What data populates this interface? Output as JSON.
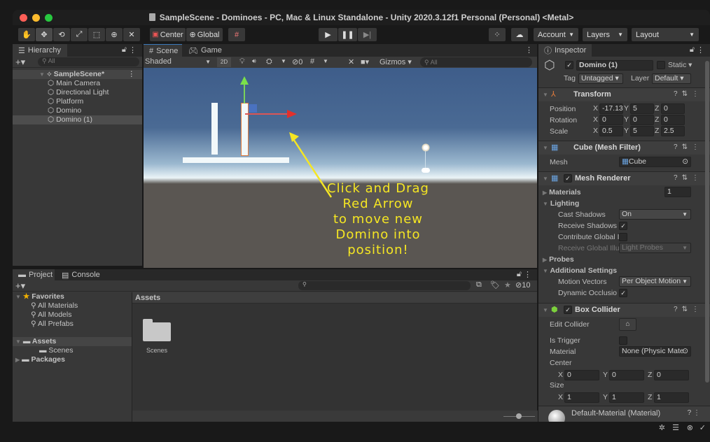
{
  "window": {
    "title": "SampleScene - Dominoes - PC, Mac & Linux Standalone - Unity 2020.3.12f1 Personal (Personal) <Metal>",
    "traffic_lights": {
      "close": "#fe5f57",
      "minimize": "#febc2e",
      "maximize": "#28c840"
    }
  },
  "toolbar": {
    "tools": [
      "hand-tool",
      "move-tool",
      "rotate-tool",
      "scale-tool",
      "rect-tool",
      "transform-tool",
      "custom-tool"
    ],
    "active_tool": "move-tool",
    "pivot_label": "Center",
    "space_label": "Global",
    "account_label": "Account",
    "layers_label": "Layers",
    "layout_label": "Layout"
  },
  "hierarchy": {
    "tab_label": "Hierarchy",
    "search_placeholder": "All",
    "scene_name": "SampleScene*",
    "items": [
      {
        "label": "Main Camera"
      },
      {
        "label": "Directional Light"
      },
      {
        "label": "Platform"
      },
      {
        "label": "Domino"
      },
      {
        "label": "Domino (1)",
        "selected": true
      }
    ]
  },
  "scene_view": {
    "tabs": [
      "Scene",
      "Game"
    ],
    "active_tab": "Scene",
    "shading_mode": "Shaded",
    "mode_2d_label": "2D",
    "hidden_count": "0",
    "gizmos_label": "Gizmos",
    "search_placeholder": "All",
    "annotation_lines": [
      "Click and Drag",
      "Red Arrow",
      "to move new",
      "Domino into",
      "position!"
    ],
    "annotation_color": "#f5e623"
  },
  "project": {
    "tabs": [
      "Project",
      "Console"
    ],
    "active_tab": "Project",
    "favorites_label": "Favorites",
    "favorites": [
      "All Materials",
      "All Models",
      "All Prefabs"
    ],
    "assets_label": "Assets",
    "assets_children": [
      "Scenes"
    ],
    "packages_label": "Packages",
    "breadcrumb": "Assets",
    "grid_items": [
      {
        "label": "Scenes",
        "type": "folder"
      }
    ],
    "hidden_packages_count": "10"
  },
  "inspector": {
    "tab_label": "Inspector",
    "object_name": "Domino (1)",
    "active": true,
    "static_label": "Static",
    "tag_label": "Tag",
    "tag_value": "Untagged",
    "layer_label": "Layer",
    "layer_value": "Default",
    "transform": {
      "title": "Transform",
      "position_label": "Position",
      "rotation_label": "Rotation",
      "scale_label": "Scale",
      "position": {
        "x": "-17.13",
        "y": "5",
        "z": "0"
      },
      "rotation": {
        "x": "0",
        "y": "0",
        "z": "0"
      },
      "scale": {
        "x": "0.5",
        "y": "5",
        "z": "2.5"
      }
    },
    "mesh_filter": {
      "title": "Cube (Mesh Filter)",
      "mesh_label": "Mesh",
      "mesh_value": "Cube"
    },
    "mesh_renderer": {
      "title": "Mesh Renderer",
      "materials_label": "Materials",
      "materials_count": "1",
      "lighting_label": "Lighting",
      "cast_shadows_label": "Cast Shadows",
      "cast_shadows_value": "On",
      "receive_shadows_label": "Receive Shadows",
      "receive_shadows": true,
      "contribute_gi_label": "Contribute Global I",
      "contribute_gi": false,
      "receive_gi_label": "Receive Global Illu",
      "receive_gi_value": "Light Probes",
      "probes_label": "Probes",
      "additional_label": "Additional Settings",
      "motion_vectors_label": "Motion Vectors",
      "motion_vectors_value": "Per Object Motion",
      "dynamic_occlusion_label": "Dynamic Occlusio",
      "dynamic_occlusion": true
    },
    "box_collider": {
      "title": "Box Collider",
      "edit_collider_label": "Edit Collider",
      "is_trigger_label": "Is Trigger",
      "is_trigger": false,
      "material_label": "Material",
      "material_value": "None (Physic Mate",
      "center_label": "Center",
      "center": {
        "x": "0",
        "y": "0",
        "z": "0"
      },
      "size_label": "Size",
      "size": {
        "x": "1",
        "y": "1",
        "z": "1"
      }
    },
    "material": {
      "title": "Default-Material (Material)"
    }
  },
  "axis_labels": {
    "x": "X",
    "y": "Y",
    "z": "Z"
  }
}
